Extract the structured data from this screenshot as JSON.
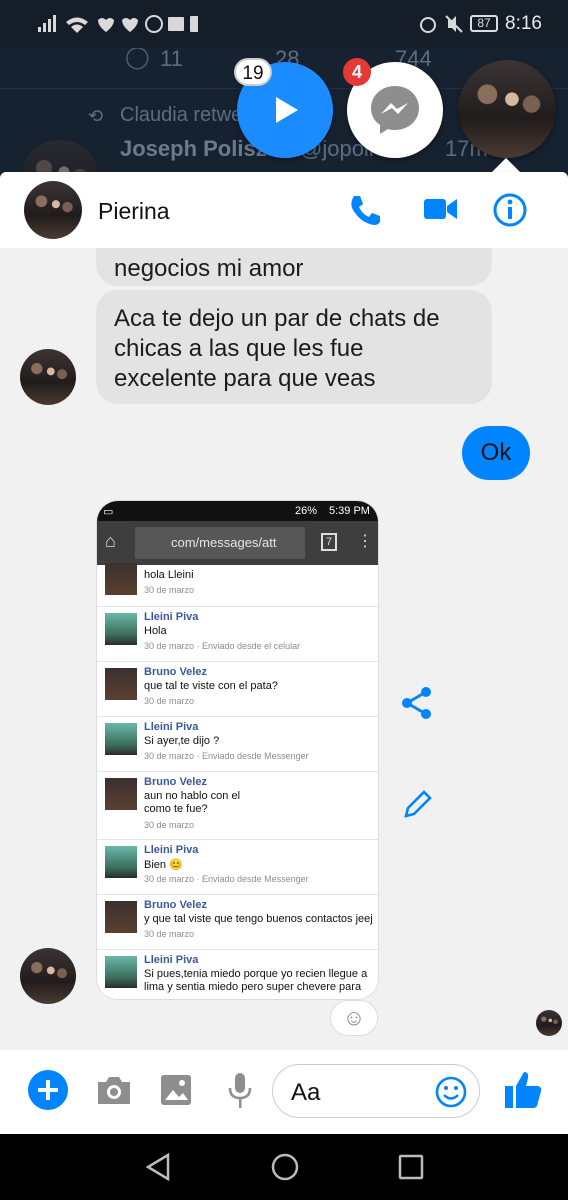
{
  "status_bar": {
    "battery": "87",
    "time": "8:16"
  },
  "background": {
    "counts": [
      "11",
      "28",
      "744"
    ],
    "retweet_text": "Claudia retwe",
    "name": "Joseph Polisz",
    "handle": "@jopoli",
    "time": "17m"
  },
  "chat_heads": [
    {
      "badge": "19",
      "color": "#1a8cff"
    },
    {
      "badge": "4",
      "color": "#ffffff"
    }
  ],
  "header": {
    "contact_name": "Pierina"
  },
  "messages": {
    "first_partial": "negocios mi amor",
    "second": [
      "Aca te dejo un par de chats de",
      "chicas a las que les fue",
      "excelente para que veas"
    ],
    "reply": "Ok"
  },
  "screenshot": {
    "status": "26%",
    "time": "5:39 PM",
    "url": "com/messages/att",
    "tabs": "7",
    "rows": [
      {
        "name": "",
        "msg": "hola Lleini",
        "date": "30 de marzo"
      },
      {
        "name": "Lleini Piva",
        "msg": "Hola",
        "date": "30 de marzo · Enviado desde el celular"
      },
      {
        "name": "Bruno Velez",
        "msg": "que tal te viste con el pata?",
        "date": "30 de marzo"
      },
      {
        "name": "Lleini Piva",
        "msg": "Si ayer,te dijo ?",
        "date": "30 de marzo · Enviado desde Messenger"
      },
      {
        "name": "Bruno Velez",
        "msg": "aun no hablo con el",
        "msg2": "como te fue?",
        "date": "30 de marzo"
      },
      {
        "name": "Lleini Piva",
        "msg": "Bien 😊",
        "date": "30 de marzo · Enviado desde Messenger"
      },
      {
        "name": "Bruno Velez",
        "msg": "y que tal viste que tengo buenos contactos jeej",
        "date": "30 de marzo"
      },
      {
        "name": "Lleini Piva",
        "msg": "Si pues,tenia miedo porque yo recien llegue a",
        "msg2": "lima y sentia miedo pero super chevere para",
        "date": ""
      }
    ]
  },
  "composer": {
    "placeholder": "Aa"
  },
  "colors": {
    "accent": "#0084ff",
    "background": "#f1f1f1"
  }
}
